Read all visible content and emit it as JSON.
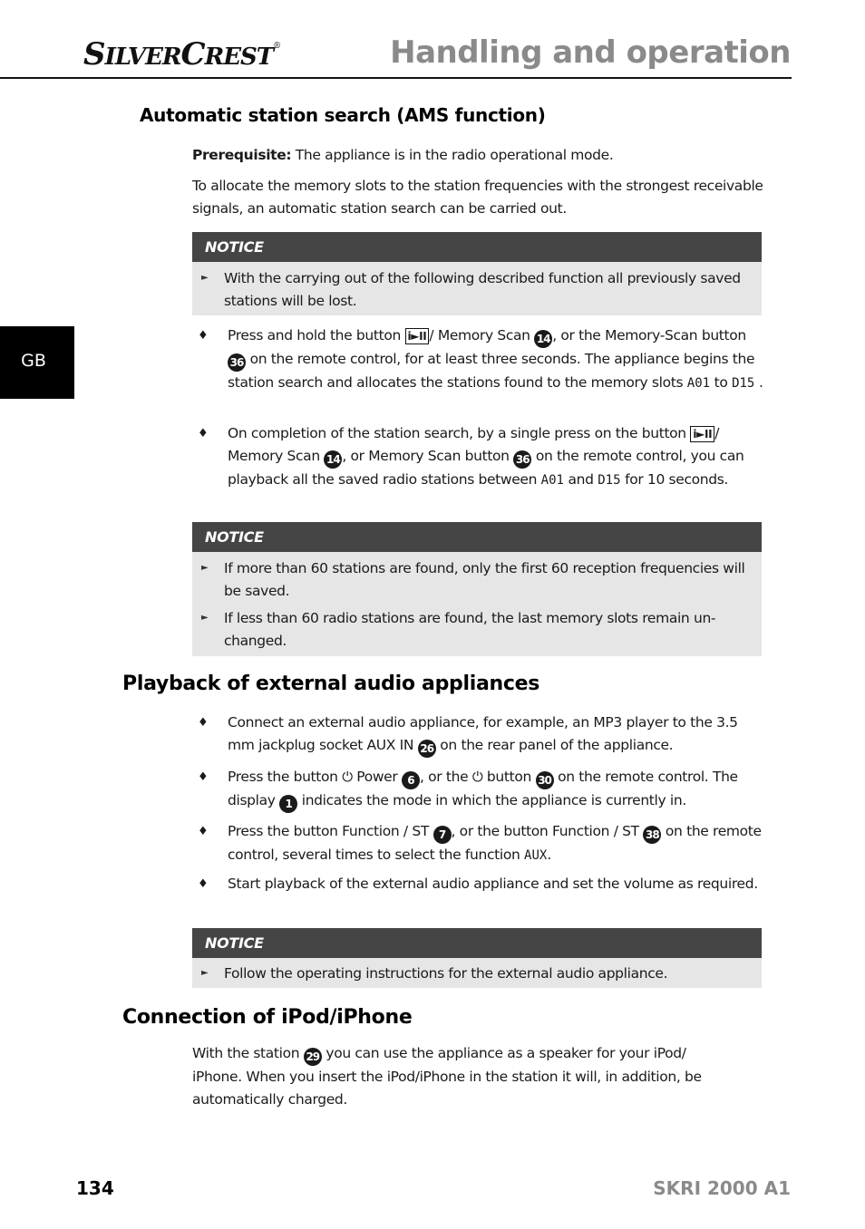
{
  "header": {
    "brand_first": "S",
    "brand_small1": "ILVER",
    "brand_second": "C",
    "brand_small2": "REST",
    "brand_reg": "®",
    "title": "Handling and operation"
  },
  "lang_tab": "GB",
  "ams": {
    "heading": "Automatic station search (AMS function)",
    "prereq_label": "Prerequisite:",
    "prereq_text": " The appliance is in the radio operational mode.",
    "intro": "To allocate the memory slots to the station frequencies with the strongest receivable signals, an automatic station search can be carried out.",
    "notice1": {
      "title": "NOTICE",
      "items": [
        "With the carrying out of the following described function all previously saved stations will be lost."
      ]
    },
    "bullet1": {
      "t1": "Press and hold the button ",
      "key": "i►II",
      "t2": "/ Memory Scan ",
      "n1": "14",
      "t3": ", or the Memory-Scan button ",
      "n2": "36",
      "t4": " on the remote control, for at least three seconds. The appliance begins the station search and allocates the stations found to the memory slots ",
      "lcd1": "A01",
      "t5": " to ",
      "lcd2": "D15",
      "t6": " ."
    },
    "bullet2": {
      "t1": "On completion of the station search, by a single press on the button ",
      "key": "i►II",
      "t2": "/ Memory Scan ",
      "n1": "14",
      "t3": ", or Memory Scan button ",
      "n2": "36",
      "t4": " on the remote control, you can playback all the saved radio stations between ",
      "lcd1": "A01",
      "t5": " and ",
      "lcd2": "D15",
      "t6": " for 10 seconds."
    },
    "notice2": {
      "title": "NOTICE",
      "items": [
        "If more than 60 stations are found, only the first 60 reception frequencies will be saved.",
        "If less than 60 radio stations are found, the last memory slots remain un-changed."
      ]
    }
  },
  "playback": {
    "heading": "Playback of external audio appliances",
    "bullet1": {
      "t1": "Connect an external audio appliance, for example, an MP3 player to the 3.5 mm jackplug socket AUX IN ",
      "n1": "26",
      "t2": " on the rear panel of the appliance."
    },
    "bullet2": {
      "t1": "Press the button ",
      "pwr": "⏻",
      "t2": " Power ",
      "n1": "6",
      "t3": ", or the ",
      "t4": " button ",
      "n2": "30",
      "t5": " on the remote control. The display ",
      "n3": "1",
      "t6": " indicates the mode in which the appliance is currently in."
    },
    "bullet3": {
      "t1": "Press the button Function / ST ",
      "n1": "7",
      "t2": ", or the button Function / ST ",
      "n2": "38",
      "t3": " on the remote control, several times to select the function ",
      "lcd": "AUX",
      "t4": "."
    },
    "bullet4": {
      "t1": "Start playback of the external audio appliance and set the volume as required."
    },
    "notice": {
      "title": "NOTICE",
      "items": [
        "Follow the operating instructions for the external audio appliance."
      ]
    }
  },
  "ipod": {
    "heading": "Connection of iPod/iPhone",
    "t1": "With the station ",
    "n1": "29",
    "t2": " you can use the appliance as a speaker for your iPod/ iPhone. When you insert the iPod/iPhone in the station it will, in addition, be automatically charged."
  },
  "footer": {
    "page_number": "134",
    "model": "SKRI 2000 A1"
  },
  "symbols": {
    "arrow": "►",
    "diamond": "♦"
  }
}
